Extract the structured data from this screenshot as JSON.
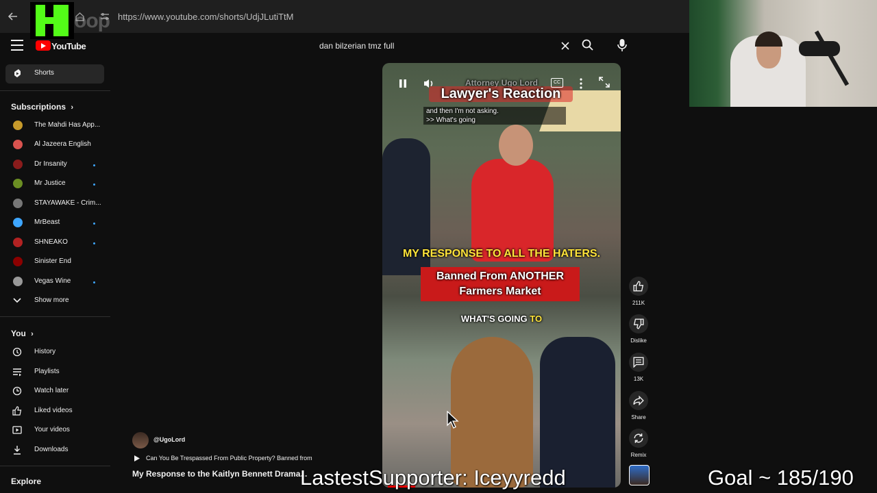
{
  "browser": {
    "url": "https://www.youtube.com/shorts/UdjJLutiTtM"
  },
  "stream_overlay": {
    "kick_word": "oop",
    "latest_supporter": "LastestSupporter: Iceyyredd",
    "goal": "Goal ~ 185/190"
  },
  "header": {
    "logo_text": "YouTube",
    "search_value": "dan bilzerian tmz full"
  },
  "sidebar": {
    "shorts_label": "Shorts",
    "subscriptions_label": "Subscriptions",
    "subscriptions": [
      {
        "label": "The Mahdi Has App...",
        "color": "#c79a2b",
        "dot": false
      },
      {
        "label": "Al Jazeera English",
        "color": "#d9534f",
        "dot": false
      },
      {
        "label": "Dr Insanity",
        "color": "#8a1c1c",
        "dot": true
      },
      {
        "label": "Mr Justice",
        "color": "#6b8e23",
        "dot": true
      },
      {
        "label": "STAYAWAKE - Crim...",
        "color": "#777777",
        "dot": false
      },
      {
        "label": "MrBeast",
        "color": "#3ea6ff",
        "dot": true
      },
      {
        "label": "SHNEAKO",
        "color": "#b22222",
        "dot": true
      },
      {
        "label": "Sinister End",
        "color": "#8b0000",
        "dot": false
      },
      {
        "label": "Vegas Wine",
        "color": "#999999",
        "dot": true
      }
    ],
    "show_more": "Show more",
    "you_label": "You",
    "you_items": [
      {
        "label": "History",
        "icon": "history-icon"
      },
      {
        "label": "Playlists",
        "icon": "playlists-icon"
      },
      {
        "label": "Watch later",
        "icon": "watch-later-icon"
      },
      {
        "label": "Liked videos",
        "icon": "liked-icon"
      },
      {
        "label": "Your videos",
        "icon": "your-videos-icon"
      },
      {
        "label": "Downloads",
        "icon": "downloads-icon"
      }
    ],
    "explore_label": "Explore"
  },
  "video": {
    "overlay_channel": "Attorney Ugo Lord",
    "overlay_banner": "Lawyer's Reaction",
    "subtitle_line1": "and then I'm not asking.",
    "subtitle_line2": ">> What's going",
    "caption_main": "MY RESPONSE TO ALL THE HATERS.",
    "caption_banner": "Banned From ANOTHER Farmers Market",
    "caption_bottom_a": "WHAT'S GOING ",
    "caption_bottom_b": "TO",
    "cc_label": "CC"
  },
  "actions": {
    "like_count": "211K",
    "dislike_label": "Dislike",
    "comment_count": "13K",
    "share_label": "Share",
    "remix_label": "Remix"
  },
  "channel": {
    "handle": "@UgoLord",
    "description": "Can You Be Trespassed From Public Property? Banned from",
    "title": "My Response to the Kaitlyn Bennett Drama..."
  }
}
